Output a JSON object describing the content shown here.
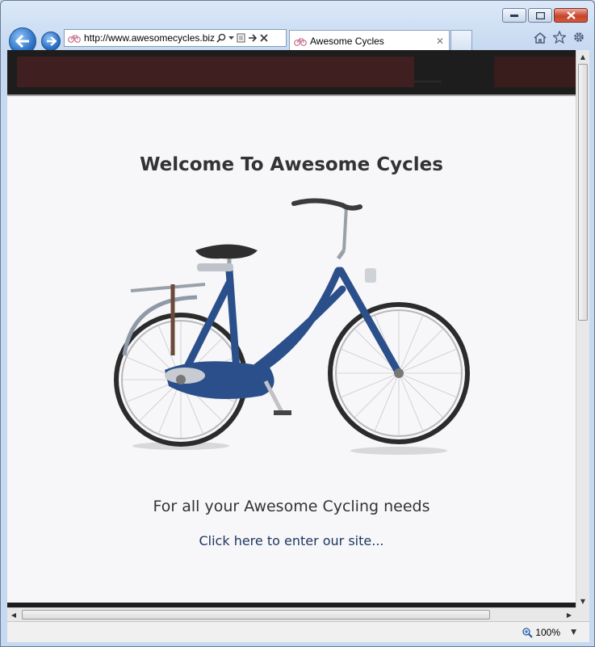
{
  "browser": {
    "address_url": "http://www.awesomecycles.biz",
    "tab_title": "Awesome Cycles",
    "zoom": "100%"
  },
  "page": {
    "title": "Welcome To Awesome Cycles",
    "tagline": "For all your Awesome Cycling needs",
    "enter_link": "Click here to enter our site..."
  },
  "colors": {
    "header_bg": "#1d1d1d",
    "header_band": "#3f1f1f",
    "page_bg": "#f7f7f9",
    "link": "#1b355e",
    "bike_frame": "#2b4f8a"
  },
  "icons": [
    "back-arrow-icon",
    "forward-arrow-icon",
    "bicycle-favicon-icon",
    "search-icon",
    "dropdown-icon",
    "compatibility-view-icon",
    "go-arrow-icon",
    "stop-icon",
    "home-icon",
    "favorites-star-icon",
    "gear-icon",
    "zoom-icon"
  ]
}
